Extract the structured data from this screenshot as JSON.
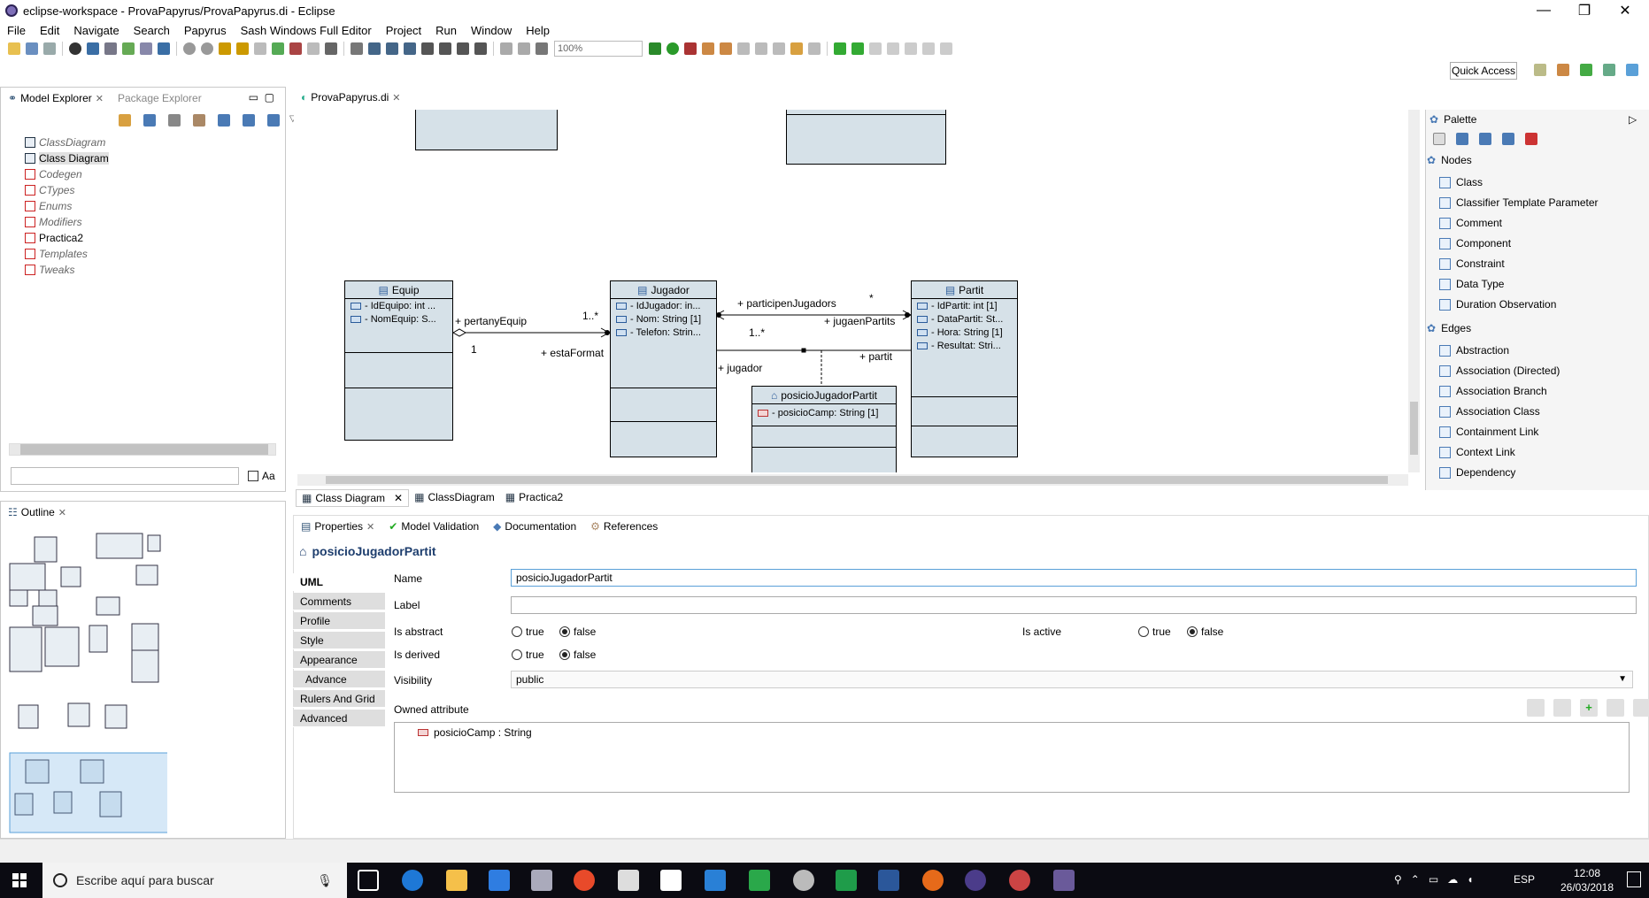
{
  "window": {
    "title": "eclipse-workspace - ProvaPapyrus/ProvaPapyrus.di - Eclipse"
  },
  "menu": [
    "File",
    "Edit",
    "Navigate",
    "Search",
    "Papyrus",
    "Sash Windows Full Editor",
    "Project",
    "Run",
    "Window",
    "Help"
  ],
  "toolbar": {
    "zoom": "100%",
    "quick_access": "Quick Access"
  },
  "model_explorer": {
    "tabs": [
      "Model Explorer",
      "Package Explorer"
    ],
    "items": [
      {
        "label": "ClassDiagram",
        "kind": "diagram",
        "style": "italic"
      },
      {
        "label": "Class Diagram",
        "kind": "diagram",
        "style": "selected"
      },
      {
        "label": "Codegen",
        "kind": "package",
        "style": "italic"
      },
      {
        "label": "CTypes",
        "kind": "package",
        "style": "italic"
      },
      {
        "label": "Enums",
        "kind": "package",
        "style": "italic"
      },
      {
        "label": "Modifiers",
        "kind": "package",
        "style": "italic"
      },
      {
        "label": "Practica2",
        "kind": "package",
        "style": "plain"
      },
      {
        "label": "Templates",
        "kind": "package",
        "style": "italic"
      },
      {
        "label": "Tweaks",
        "kind": "package",
        "style": "italic"
      }
    ],
    "filter_placeholder": "",
    "case_label": "Aa"
  },
  "outline": {
    "tab": "Outline"
  },
  "editor": {
    "tab": "ProvaPapyrus.di",
    "bottom_tabs": [
      "Class Diagram",
      "ClassDiagram",
      "Practica2"
    ],
    "classes": {
      "equip": {
        "name": "Equip",
        "attrs": [
          "- IdEquipo: int ...",
          "- NomEquip: S..."
        ]
      },
      "jugador": {
        "name": "Jugador",
        "attrs": [
          "- IdJugador: in...",
          "- Nom: String [1]",
          "- Telefon: Strin..."
        ]
      },
      "partit": {
        "name": "Partit",
        "attrs": [
          "- IdPartit: int [1]",
          "- DataPartit: St...",
          "- Hora: String [1]",
          "- Resultat: Stri..."
        ]
      },
      "posicio": {
        "name": "posicioJugadorPartit",
        "attrs": [
          "- posicioCamp: String [1]"
        ]
      }
    },
    "labels": {
      "pertanyEquip": "+ pertanyEquip",
      "mult1n": "1..*",
      "one": "1",
      "estaFormat": "+ estaFormat",
      "participenJugadors": "+ participenJugadors",
      "star": "*",
      "jugaenPartits": "+ jugaenPartits",
      "mult1n_b": "1..*",
      "jugador": "+ jugador",
      "partit": "+ partit"
    }
  },
  "palette": {
    "title": "Palette",
    "nodes_header": "Nodes",
    "nodes": [
      "Class",
      "Classifier Template Parameter",
      "Comment",
      "Component",
      "Constraint",
      "Data Type",
      "Duration Observation"
    ],
    "edges_header": "Edges",
    "edges": [
      "Abstraction",
      "Association (Directed)",
      "Association Branch",
      "Association Class",
      "Containment Link",
      "Context Link",
      "Dependency"
    ]
  },
  "properties": {
    "tabs": [
      "Properties",
      "Model Validation",
      "Documentation",
      "References"
    ],
    "title": "posicioJugadorPartit",
    "side_tabs": [
      "UML",
      "Comments",
      "Profile",
      "Style",
      "Appearance",
      "Advance",
      "Rulers And Grid",
      "Advanced"
    ],
    "name_label": "Name",
    "name_value": "posicioJugadorPartit",
    "label_label": "Label",
    "label_value": "",
    "is_abstract": "Is abstract",
    "is_active": "Is active",
    "is_derived": "Is derived",
    "true_label": "true",
    "false_label": "false",
    "visibility_label": "Visibility",
    "visibility_value": "public",
    "owned_attribute_label": "Owned attribute",
    "owned_attributes": [
      "posicioCamp : String"
    ]
  },
  "taskbar": {
    "search_placeholder": "Escribe aquí para buscar",
    "lang": "ESP",
    "time": "12:08",
    "date": "26/03/2018"
  }
}
